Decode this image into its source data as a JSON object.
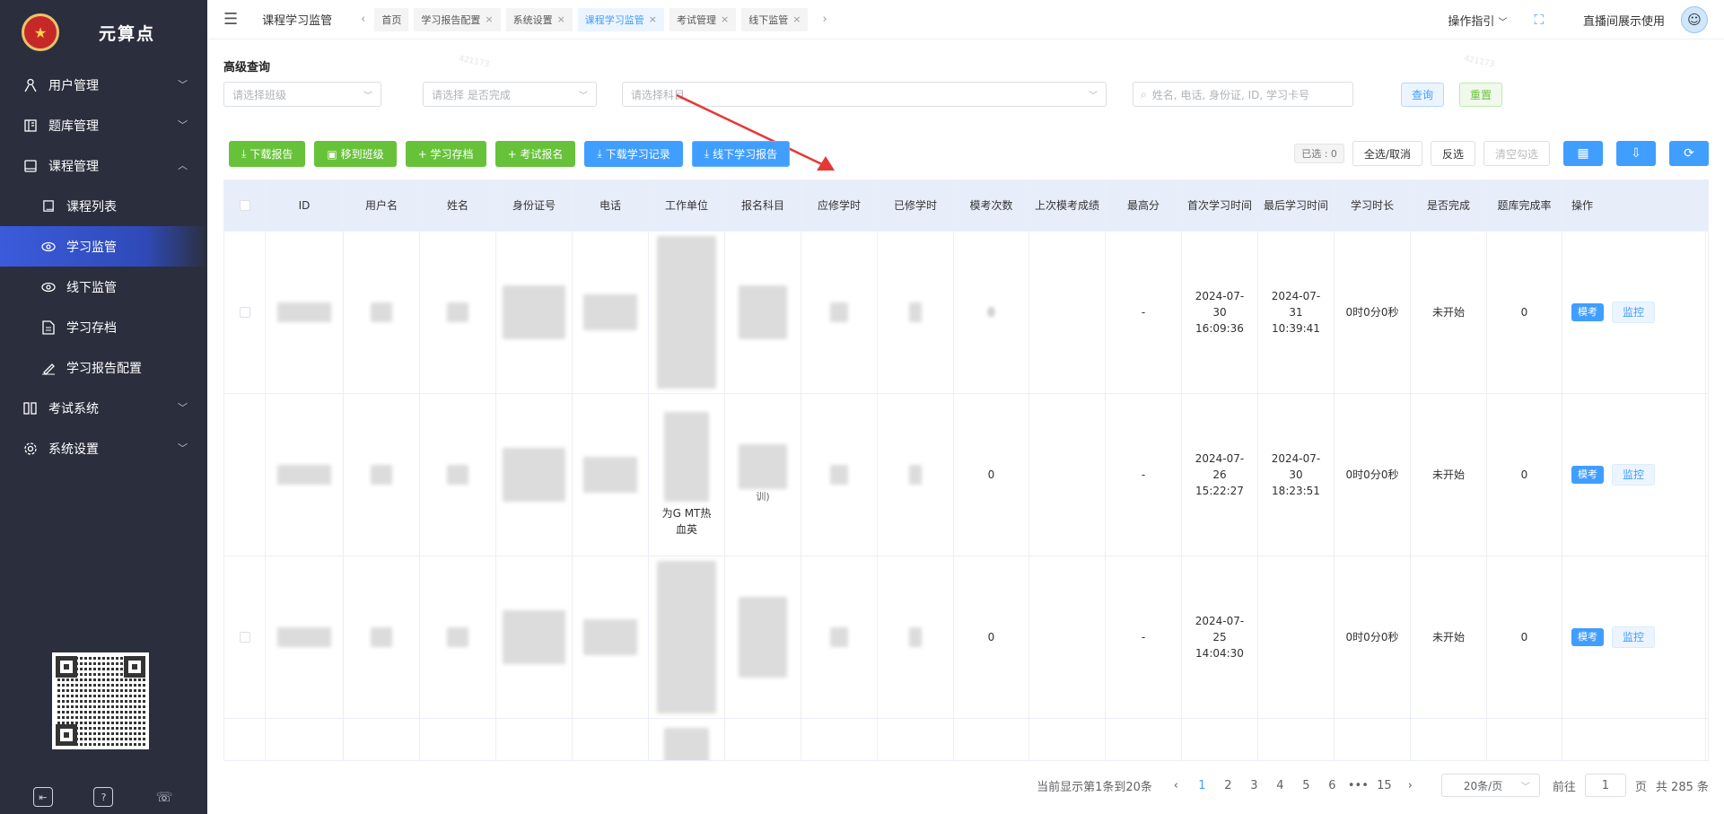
{
  "sidebar": {
    "logo_text": "元算点",
    "menu": [
      {
        "label": "用户管理",
        "icon": "user-icon"
      },
      {
        "label": "题库管理",
        "icon": "book-icon"
      },
      {
        "label": "课程管理",
        "icon": "course-icon"
      }
    ],
    "course_sub": [
      {
        "label": "课程列表",
        "icon": "book-icon"
      },
      {
        "label": "学习监管",
        "icon": "eye-icon",
        "active": true
      },
      {
        "label": "线下监管",
        "icon": "eye-icon"
      },
      {
        "label": "学习存档",
        "icon": "file-icon"
      },
      {
        "label": "学习报告配置",
        "icon": "edit-icon"
      }
    ],
    "menu2": [
      {
        "label": "考试系统",
        "icon": "exam-icon"
      },
      {
        "label": "系统设置",
        "icon": "gear-icon"
      }
    ]
  },
  "topbar": {
    "current": "课程学习监管",
    "tabs": [
      "首页",
      "学习报告配置",
      "系统设置",
      "课程学习监管",
      "考试管理",
      "线下监管"
    ],
    "active_tab": "课程学习监管",
    "guide": "操作指引",
    "user": "直播间展示使用"
  },
  "filters": {
    "title": "高级查询",
    "class_placeholder": "请选择班级",
    "done_placeholder": "请选择 是否完成",
    "subject_placeholder": "请选择科目",
    "search_placeholder": "姓名, 电话, 身份证, ID, 学习卡号",
    "query_label": "查询",
    "reset_label": "重置"
  },
  "toolbar": {
    "download_report": "下载报告",
    "move_class": "移到班级",
    "study_archive": "+ 学习存档",
    "exam_signup": "+ 考试报名",
    "download_records": "下载学习记录",
    "offline_report": "线下学习报告",
    "selected": "已选 : 0",
    "select_all": "全选/取消",
    "invert": "反选",
    "clear": "清空勾选"
  },
  "table": {
    "columns": [
      "ID",
      "用户名",
      "姓名",
      "身份证号",
      "电话",
      "工作单位",
      "报名科目",
      "应修学时",
      "已修学时",
      "模考次数",
      "上次模考成绩",
      "最高分",
      "首次学习时间",
      "最后学习时间",
      "学习时长",
      "是否完成",
      "题库完成率",
      "操作"
    ],
    "rows": [
      {
        "mock_count": "0",
        "best": "-",
        "first": "2024-07-30 16:09:36",
        "last": "2024-07-31 10:39:41",
        "duration": "0时0分0秒",
        "done": "未开始",
        "rate": "0",
        "unit_text": "",
        "subject_text": ""
      },
      {
        "mock_count": "0",
        "best": "-",
        "first": "2024-07-26 15:22:27",
        "last": "2024-07-30 18:23:51",
        "duration": "0时0分0秒",
        "done": "未开始",
        "rate": "0",
        "unit_text": "为G MT热血英",
        "subject_text": "训)"
      },
      {
        "mock_count": "0",
        "best": "-",
        "first": "2024-07-25 14:04:30",
        "last": "",
        "duration": "0时0分0秒",
        "done": "未开始",
        "rate": "0",
        "unit_text": "",
        "subject_text": ""
      }
    ],
    "op_mock": "模考",
    "op_monitor": "监控"
  },
  "pagination": {
    "summary": "当前显示第1条到20条",
    "pages": [
      "1",
      "2",
      "3",
      "4",
      "5",
      "6",
      "•••",
      "15"
    ],
    "page_size": "20条/页",
    "goto_label": "前往",
    "goto_value": "1",
    "page_unit": "页",
    "total": "共 285 条"
  },
  "watermark": "421173",
  "colors": {
    "sidebar": "#2b2f3d",
    "primary": "#409eff",
    "success": "#67c23a",
    "annotation": "#e53935"
  }
}
